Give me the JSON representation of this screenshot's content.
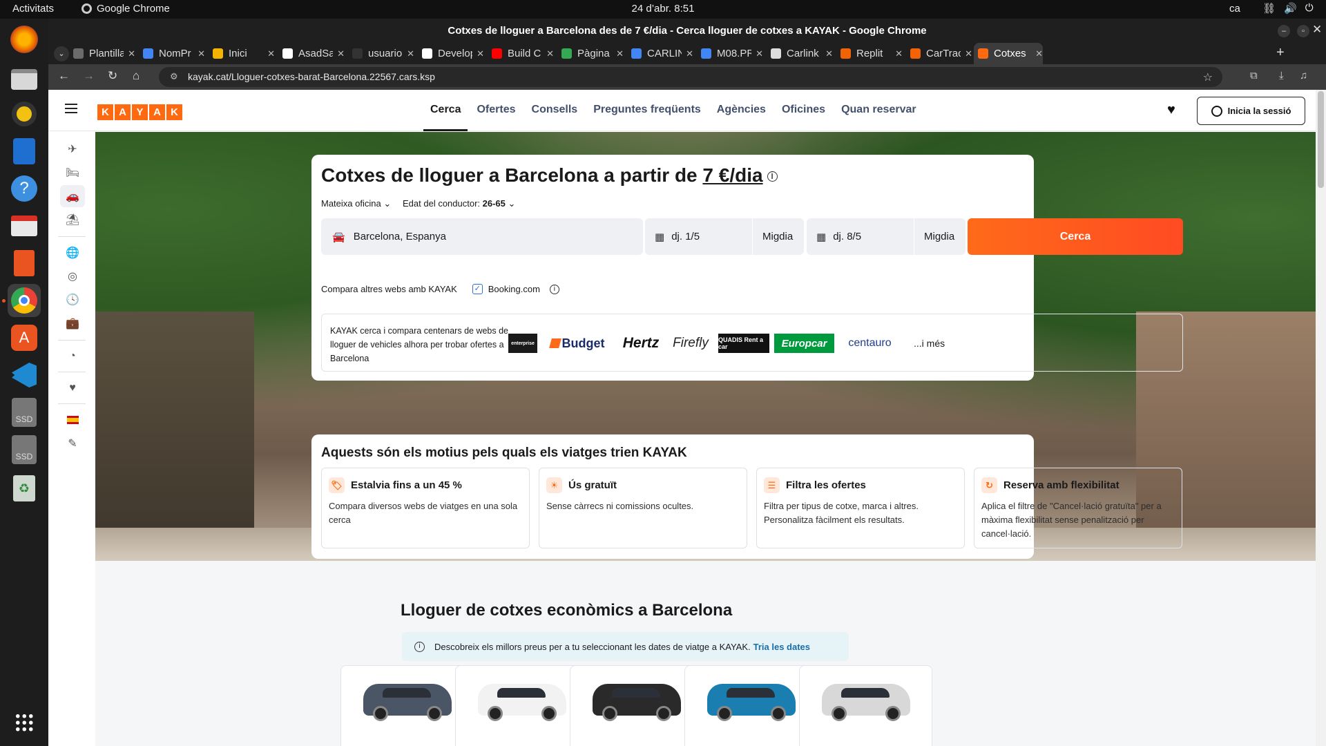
{
  "system": {
    "activities": "Activitats",
    "app_name": "Google Chrome",
    "clock": "24 d’abr.  8:51",
    "lang": "ca"
  },
  "window": {
    "title": "Cotxes de lloguer a Barcelona des de 7 €/dia - Cerca lloguer de cotxes a KAYAK - Google Chrome"
  },
  "tabs": [
    {
      "label": "Plantilla",
      "color": "#6b6b6b"
    },
    {
      "label": "NomPr",
      "color": "#4285f4"
    },
    {
      "label": "Inici",
      "color": "#f4b400"
    },
    {
      "label": "AsadSa",
      "color": "#ffffff"
    },
    {
      "label": "usuario",
      "color": "#333333"
    },
    {
      "label": "Develop",
      "color": "#ffffff"
    },
    {
      "label": "Build C",
      "color": "#ff0000"
    },
    {
      "label": "Pàgina",
      "color": "#34a853"
    },
    {
      "label": "CARLIN",
      "color": "#4285f4"
    },
    {
      "label": "M08.PR",
      "color": "#4285f4"
    },
    {
      "label": "Carlink",
      "color": "#dddddd"
    },
    {
      "label": "Replit",
      "color": "#f26207"
    },
    {
      "label": "CarTrac",
      "color": "#f26207"
    },
    {
      "label": "Cotxes",
      "color": "#ff690f"
    }
  ],
  "url": "kayak.cat/Lloguer-cotxes-barat-Barcelona.22567.cars.ksp",
  "kayak": {
    "logo_letters": [
      "K",
      "A",
      "Y",
      "A",
      "K"
    ],
    "nav": [
      "Cerca",
      "Ofertes",
      "Consells",
      "Preguntes freqüents",
      "Agències",
      "Oficines",
      "Quan reservar"
    ],
    "signin": "Inicia la sessió"
  },
  "search": {
    "title_prefix": "Cotxes de lloguer a Barcelona a partir de ",
    "title_price": "7 €/dia",
    "office": "Mateixa oficina",
    "driver_age_label": "Edat del conductor: ",
    "driver_age_value": "26-65",
    "location": "Barcelona, Espanya",
    "pickup_date": "dj. 1/5",
    "pickup_time": "Migdia",
    "dropoff_date": "dj. 8/5",
    "dropoff_time": "Migdia",
    "button": "Cerca",
    "compare_label": "Compara altres webs amb KAYAK",
    "compare_site": "Booking.com",
    "compare_checked": true,
    "brands_desc": "KAYAK cerca i compara centenars de webs de lloguer de vehicles alhora per trobar ofertes a Barcelona",
    "brands": [
      "enterprise",
      "Budget",
      "Hertz",
      "Firefly",
      "QUADIS Rent a car",
      "Europcar",
      "centauro"
    ],
    "more": "...i més"
  },
  "why": {
    "title": "Aquests són els motius pels quals els viatges trien KAYAK",
    "items": [
      {
        "title": "Estalvia fins a un 45 %",
        "text": "Compara diversos webs de viatges en una sola cerca"
      },
      {
        "title": "Ús gratuït",
        "text": "Sense càrrecs ni comissions ocultes."
      },
      {
        "title": "Filtra les ofertes",
        "text": "Filtra per tipus de cotxe, marca i altres. Personalitza fàcilment els resultats."
      },
      {
        "title": "Reserva amb flexibilitat",
        "text": "Aplica el filtre de \"Cancel·lació gratuïta\" per a màxima flexibilitat sense penalització per cancel·lació."
      }
    ]
  },
  "cheap": {
    "title": "Lloguer de cotxes econòmics a Barcelona",
    "banner_text": "Descobreix els millors preus per a tu seleccionant les dates de viatge a KAYAK.",
    "banner_link": "Tria les dates",
    "car_colors": [
      "#4a5566",
      "#f2f2f2",
      "#2a2a2a",
      "#1a7fb0",
      "#d8d8d8"
    ]
  }
}
